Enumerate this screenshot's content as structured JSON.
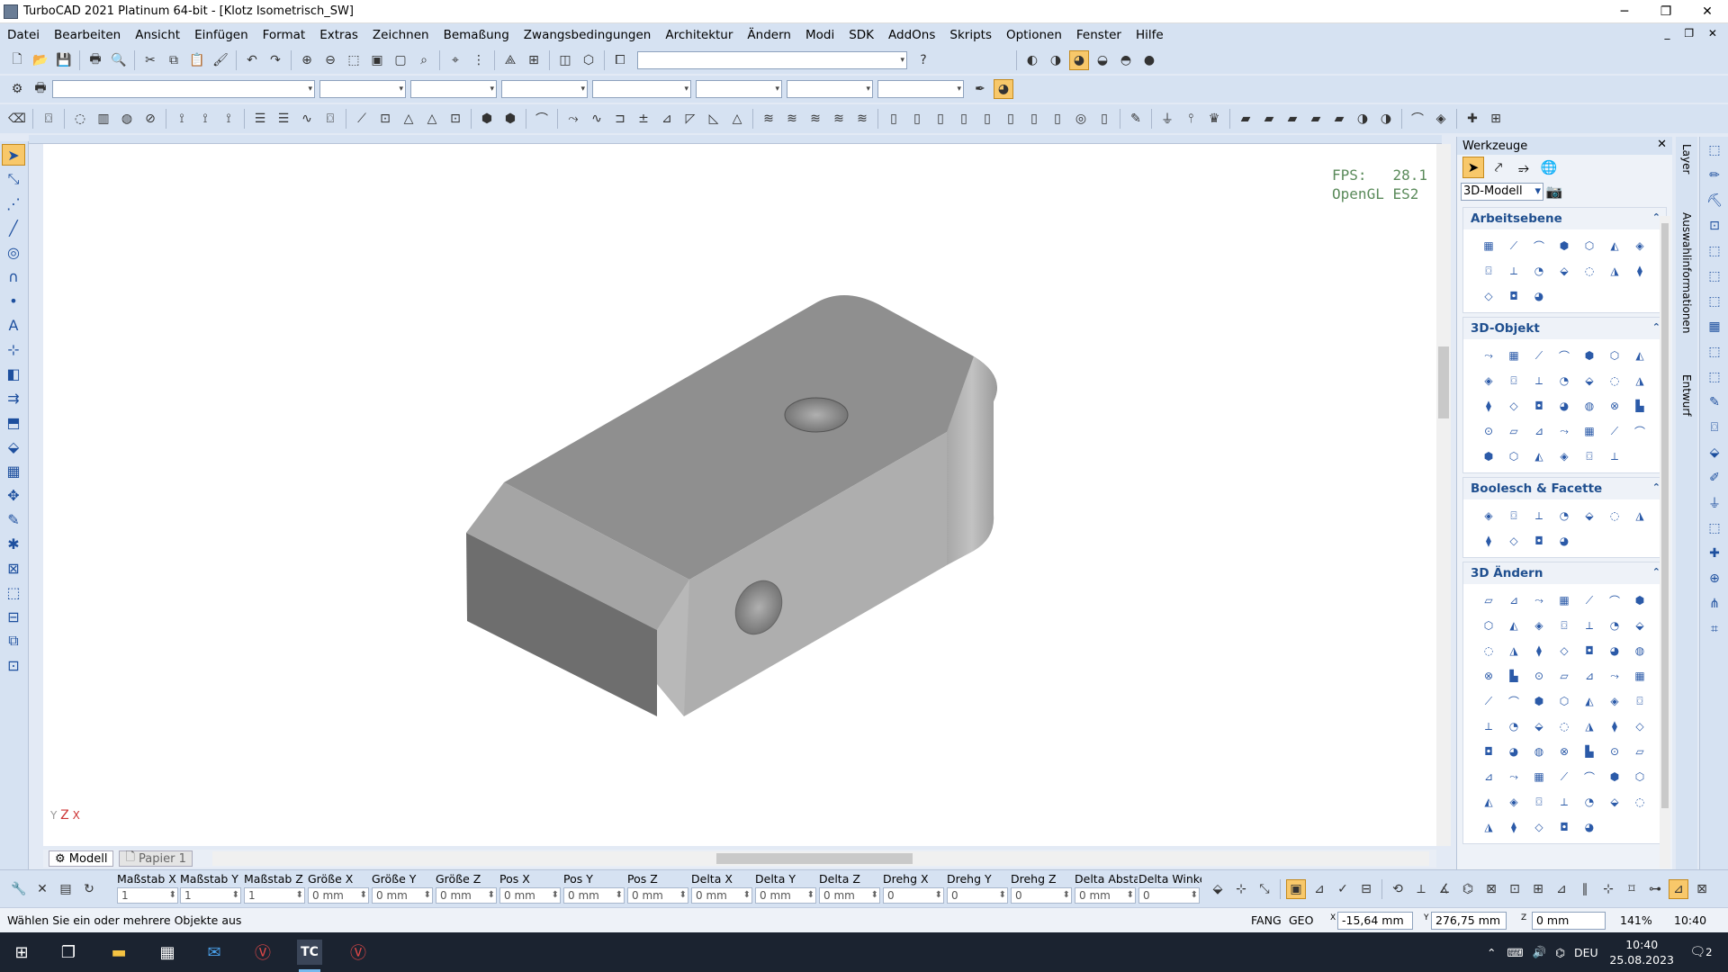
{
  "window": {
    "title": "TurboCAD 2021 Platinum 64-bit - [Klotz Isometrisch_SW]",
    "minimize": "─",
    "restore": "❐",
    "close": "✕",
    "mdi": "_ ❐ ✕"
  },
  "menu": [
    "Datei",
    "Bearbeiten",
    "Ansicht",
    "Einfügen",
    "Format",
    "Extras",
    "Zeichnen",
    "Bemaßung",
    "Zwangsbedingungen",
    "Architektur",
    "Ändern",
    "Modi",
    "SDK",
    "AddOns",
    "Skripts",
    "Optionen",
    "Fenster",
    "Hilfe"
  ],
  "viewport": {
    "fps_label": "FPS:",
    "fps_value": "28.1",
    "renderer": "OpenGL ES2",
    "axis_y": "Y",
    "axis_z": "Z",
    "axis_x": "X"
  },
  "tabs": {
    "model": "Modell",
    "paper": "Papier 1"
  },
  "panel": {
    "title": "Werkzeuge",
    "close": "✕",
    "pin": "📌",
    "mode": "3D-Modell",
    "sections": [
      {
        "title": "Arbeitsebene",
        "count": 17
      },
      {
        "title": "3D-Objekt",
        "count": 34
      },
      {
        "title": "Boolesch & Facette",
        "count": 11
      },
      {
        "title": "3D Ändern",
        "count": 68
      }
    ]
  },
  "sidetabs": {
    "layer": "Layer",
    "auswahl": "Auswahlinformationen",
    "entwurf": "Entwurf"
  },
  "inspector": [
    {
      "label": "Maßstab X",
      "value": "1"
    },
    {
      "label": "Maßstab Y",
      "value": "1"
    },
    {
      "label": "Maßstab Z",
      "value": "1"
    },
    {
      "label": "Größe X",
      "value": "0 mm"
    },
    {
      "label": "Größe Y",
      "value": "0 mm"
    },
    {
      "label": "Größe Z",
      "value": "0 mm"
    },
    {
      "label": "Pos X",
      "value": "0 mm"
    },
    {
      "label": "Pos Y",
      "value": "0 mm"
    },
    {
      "label": "Pos Z",
      "value": "0 mm"
    },
    {
      "label": "Delta X",
      "value": "0 mm"
    },
    {
      "label": "Delta Y",
      "value": "0 mm"
    },
    {
      "label": "Delta Z",
      "value": "0 mm"
    },
    {
      "label": "Drehg X",
      "value": "0"
    },
    {
      "label": "Drehg Y",
      "value": "0"
    },
    {
      "label": "Drehg Z",
      "value": "0"
    },
    {
      "label": "Delta Absta",
      "value": "0 mm"
    },
    {
      "label": "Delta Winke",
      "value": "0"
    }
  ],
  "status": {
    "hint": "Wählen Sie ein oder mehrere Objekte aus",
    "fang": "FANG",
    "geo": "GEO",
    "x_label": "X",
    "x": "-15,64 mm",
    "y_label": "Y",
    "y": "276,75 mm",
    "z_label": "Z",
    "z": "0 mm",
    "zoom": "141%",
    "time": "10:40"
  },
  "taskbar": {
    "lang": "DEU",
    "time": "10:40",
    "date": "25.08.2023",
    "notifications": "2",
    "tc_label": "TC"
  },
  "colors": {
    "accent": "#f8c86a",
    "panel_heading": "#1f4f8f",
    "toolbar": "#d6e2f2"
  }
}
